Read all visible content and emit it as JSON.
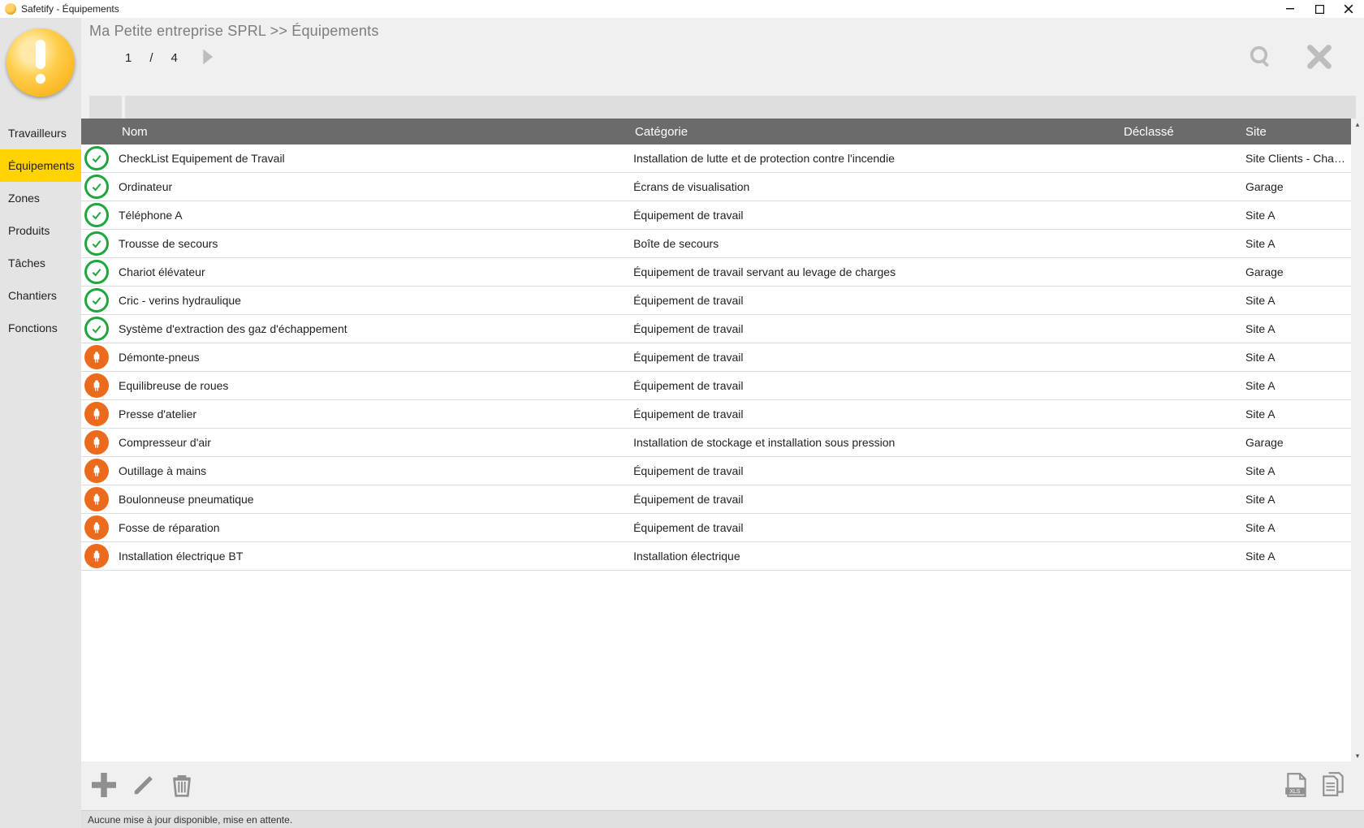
{
  "window": {
    "title": "Safetify - Équipements"
  },
  "breadcrumb": "Ma Petite entreprise SPRL >> Équipements",
  "pager": {
    "current": "1",
    "separator": "/",
    "total": "4"
  },
  "sidebar": {
    "items": [
      {
        "label": "Travailleurs",
        "active": false
      },
      {
        "label": "Équipements",
        "active": true
      },
      {
        "label": "Zones",
        "active": false
      },
      {
        "label": "Produits",
        "active": false
      },
      {
        "label": "Tâches",
        "active": false
      },
      {
        "label": "Chantiers",
        "active": false
      },
      {
        "label": "Fonctions",
        "active": false
      }
    ]
  },
  "table": {
    "headers": {
      "name": "Nom",
      "category": "Catégorie",
      "declassified": "Déclassé",
      "site": "Site"
    },
    "rows": [
      {
        "status": "ok",
        "name": "CheckList Equipement de Travail",
        "category": "Installation de lutte et de protection contre l'incendie",
        "declassified": "",
        "site": "Site Clients - Chantier"
      },
      {
        "status": "ok",
        "name": "Ordinateur",
        "category": "Écrans de visualisation",
        "declassified": "",
        "site": "Garage"
      },
      {
        "status": "ok",
        "name": "Téléphone A",
        "category": "Équipement de travail",
        "declassified": "",
        "site": "Site A"
      },
      {
        "status": "ok",
        "name": "Trousse de secours",
        "category": "Boîte de secours",
        "declassified": "",
        "site": "Site A"
      },
      {
        "status": "ok",
        "name": "Chariot élévateur",
        "category": "Équipement de travail servant au levage de charges",
        "declassified": "",
        "site": "Garage"
      },
      {
        "status": "ok",
        "name": "Cric - verins hydraulique",
        "category": "Équipement de travail",
        "declassified": "",
        "site": "Site A"
      },
      {
        "status": "ok",
        "name": "Système d'extraction des gaz d'échappement",
        "category": "Équipement de travail",
        "declassified": "",
        "site": "Site A"
      },
      {
        "status": "warn",
        "name": "Démonte-pneus",
        "category": "Équipement de travail",
        "declassified": "",
        "site": "Site A"
      },
      {
        "status": "warn",
        "name": "Equilibreuse de roues",
        "category": "Équipement de travail",
        "declassified": "",
        "site": "Site A"
      },
      {
        "status": "warn",
        "name": "Presse d'atelier",
        "category": "Équipement de travail",
        "declassified": "",
        "site": "Site A"
      },
      {
        "status": "warn",
        "name": "Compresseur d'air",
        "category": "Installation de stockage et installation sous pression",
        "declassified": "",
        "site": "Garage"
      },
      {
        "status": "warn",
        "name": "Outillage à mains",
        "category": "Équipement de travail",
        "declassified": "",
        "site": "Site A"
      },
      {
        "status": "warn",
        "name": "Boulonneuse pneumatique",
        "category": "Équipement de travail",
        "declassified": "",
        "site": "Site A"
      },
      {
        "status": "warn",
        "name": "Fosse de réparation",
        "category": "Équipement de travail",
        "declassified": "",
        "site": "Site A"
      },
      {
        "status": "warn",
        "name": "Installation électrique BT",
        "category": "Installation électrique",
        "declassified": "",
        "site": "Site A"
      }
    ]
  },
  "export": {
    "xls_label": "XLS"
  },
  "statusbar": {
    "text": "Aucune mise à jour disponible, mise en attente."
  }
}
